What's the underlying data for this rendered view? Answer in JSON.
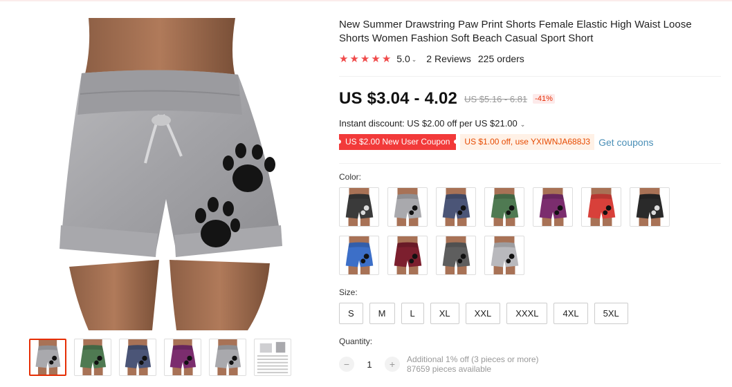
{
  "product": {
    "title": "New Summer Drawstring Paw Print Shorts Female Elastic High Waist Loose Shorts Women Fashion Soft Beach Casual Sport Short",
    "rating": "5.0",
    "stars": 5,
    "reviews": "2 Reviews",
    "orders": "225 orders"
  },
  "pricing": {
    "price": "US $3.04 - 4.02",
    "old_price": "US $5.16 - 6.81",
    "discount": "-41%",
    "instant_discount": "Instant discount: US $2.00 off per US $21.00"
  },
  "coupons": {
    "new_user": "US $2.00 New User Coupon",
    "code_offer": "US $1.00 off, use YXIWNJA688J3",
    "get_link": "Get coupons"
  },
  "color_label": "Color:",
  "colors": [
    {
      "name": "black",
      "hex": "#3a3a3a"
    },
    {
      "name": "gray",
      "hex": "#a9a9ad"
    },
    {
      "name": "navy",
      "hex": "#4b5577"
    },
    {
      "name": "green",
      "hex": "#4f7a52"
    },
    {
      "name": "purple",
      "hex": "#7b2d6e"
    },
    {
      "name": "red",
      "hex": "#d8403a"
    },
    {
      "name": "dark-black",
      "hex": "#2a2a2a"
    },
    {
      "name": "blue",
      "hex": "#3c6fc8"
    },
    {
      "name": "wine",
      "hex": "#7c1f2e"
    },
    {
      "name": "dark-gray",
      "hex": "#5e5e5e"
    },
    {
      "name": "light-gray",
      "hex": "#b9b9bd"
    }
  ],
  "size_label": "Size:",
  "sizes": [
    "S",
    "M",
    "L",
    "XL",
    "XXL",
    "XXXL",
    "4XL",
    "5XL"
  ],
  "quantity": {
    "label": "Quantity:",
    "value": "1",
    "minus": "−",
    "plus": "+",
    "offer": "Additional 1% off (3 pieces or more)",
    "available": "87659 pieces available"
  },
  "thumbnails": [
    {
      "name": "gray",
      "hex": "#a9a9ad"
    },
    {
      "name": "green",
      "hex": "#4f7a52"
    },
    {
      "name": "navy",
      "hex": "#4b5577"
    },
    {
      "name": "purple",
      "hex": "#7b2d6e"
    },
    {
      "name": "gray-multi",
      "hex": "#a9a9ad"
    },
    {
      "name": "size-chart",
      "hex": "#e8e8e8"
    }
  ],
  "theme": {
    "accent": "#e62e04",
    "star": "#f04a4a",
    "coupon_red": "#f23a3a",
    "link": "#4a8fb7"
  }
}
